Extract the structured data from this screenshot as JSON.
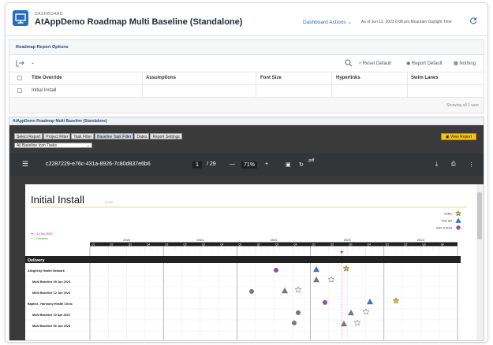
{
  "header": {
    "breadcrumb": "DASHBOARD",
    "title": "AtAppDemo Roadmap Multi Baseline (Standalone)",
    "actions_label": "Dashboard Actions",
    "as_of": "As of  Jun 12, 2023 6:08 pm Mountain Daylight Time"
  },
  "options": {
    "title": "Roadmap Report Options",
    "toolbar": {
      "reset_default": "Reset Default",
      "report_default": "Report Default",
      "nothing": "Nothing"
    },
    "columns": [
      "Title Override",
      "Assumptions",
      "Font Size",
      "Hyperlinks",
      "Swim Lanes"
    ],
    "rows": [
      {
        "title_override": "Initial Install"
      }
    ],
    "footer": "Showing all 1 user"
  },
  "report": {
    "title": "AtAppDemo Roadmap Multi Baseline (Standalone)",
    "tabs": [
      "Select Report",
      "Project Filter",
      "Task Filter",
      "Baseline Task Filter",
      "Dates",
      "Report Settings"
    ],
    "active_tab": "Baseline Task Filter",
    "filter_select": "All Baseline Icon Tasks",
    "view_report": "View Report"
  },
  "pdf": {
    "doc_id": "c2287229-e76c-431a-8926-7c80d837e6b6",
    "page_current": "1",
    "page_total": "/ 29",
    "zoom": "71%",
    "ext": ".pdf"
  },
  "roadmap": {
    "title": "Initial Install",
    "version": "v1.00",
    "legend": [
      {
        "label": "Golive",
        "shape": "star",
        "color": "#e8c31a"
      },
      {
        "label": "Plan Set",
        "shape": "triangle",
        "color": "#3b74c4"
      },
      {
        "label": "Start of Build",
        "shape": "circle",
        "color": "#9b4aa8"
      }
    ],
    "today_marker": "= 12 Jun 2023",
    "complete_marker": "= Complete",
    "years": [
      "2020",
      "2021",
      "2022",
      "2023",
      "2024"
    ],
    "quarters": [
      "Q1",
      "Q2",
      "Q3",
      "Q4",
      "Q1",
      "Q2",
      "Q3",
      "Q4",
      "Q1",
      "Q2",
      "Q3",
      "Q4",
      "Q1",
      "Q2",
      "Q3",
      "Q4",
      "Q1",
      "Q2",
      "Q3",
      "Q4"
    ],
    "section": "Delivery",
    "rows": [
      {
        "label": "Allegheny Health Network",
        "indent": false
      },
      {
        "label": "Multi Baseline 05 Jun 2023",
        "indent": true
      },
      {
        "label": "Multi Baseline 12 Jun 2023",
        "indent": true
      },
      {
        "label": "Baptist - Harmony Health Clinic",
        "indent": false
      },
      {
        "label": "Multi Baseline 10 Apr 2023",
        "indent": true
      },
      {
        "label": "Multi Baseline 06 Jun 2023",
        "indent": true
      }
    ]
  }
}
